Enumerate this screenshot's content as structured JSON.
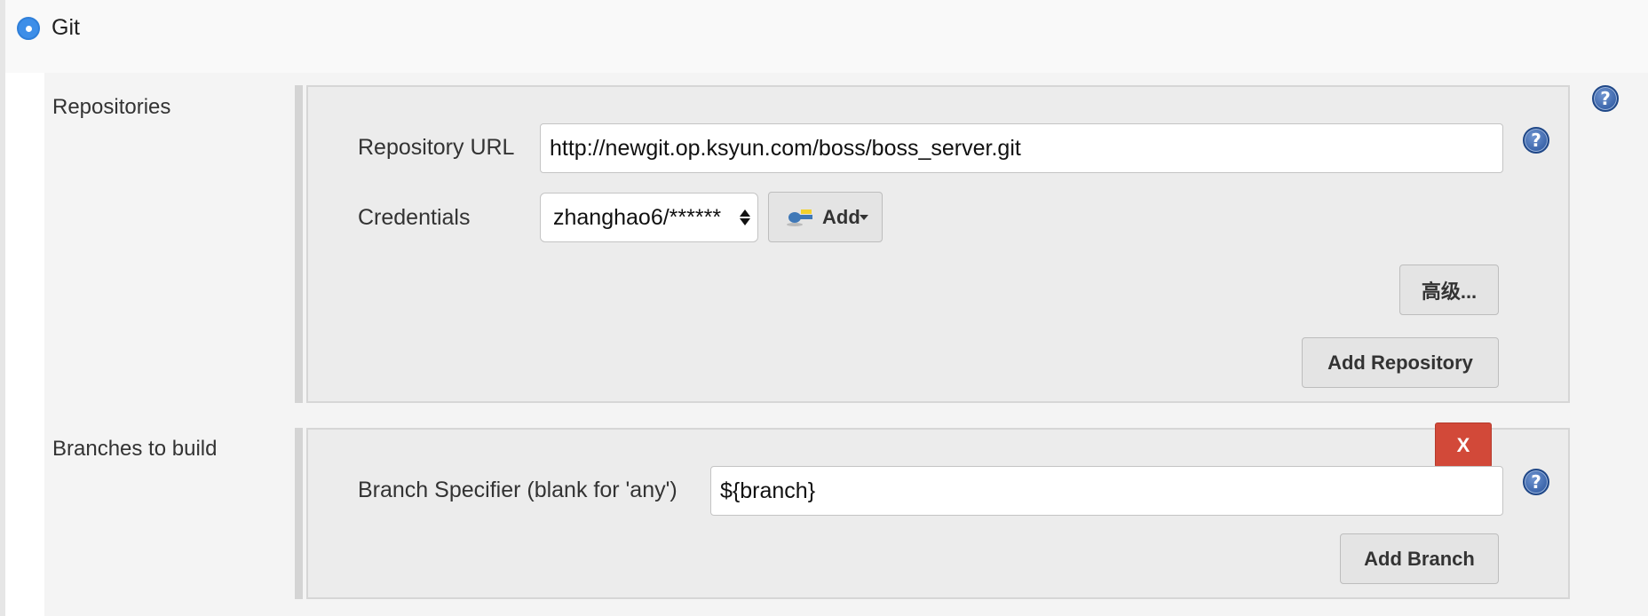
{
  "scm": {
    "label": "Git",
    "selected": true
  },
  "repositories": {
    "section_label": "Repositories",
    "url_label": "Repository URL",
    "url_value": "http://newgit.op.ksyun.com/boss/boss_server.git",
    "credentials_label": "Credentials",
    "credentials_value": "zhanghao6/******",
    "add_button_label": "Add",
    "advanced_button_label": "高级...",
    "add_repository_label": "Add Repository"
  },
  "branches": {
    "section_label": "Branches to build",
    "specifier_label": "Branch Specifier (blank for 'any')",
    "specifier_value": "${branch}",
    "delete_label": "X",
    "add_branch_label": "Add Branch"
  },
  "help": {
    "glyph": "?"
  },
  "icons": {
    "radio": "radio-selected-icon",
    "key": "key-icon",
    "dropdown": "dropdown-arrow-icon",
    "help": "help-icon"
  },
  "colors": {
    "radio": "#3d8ee8",
    "delete": "#d24939",
    "help": "#24509a"
  }
}
